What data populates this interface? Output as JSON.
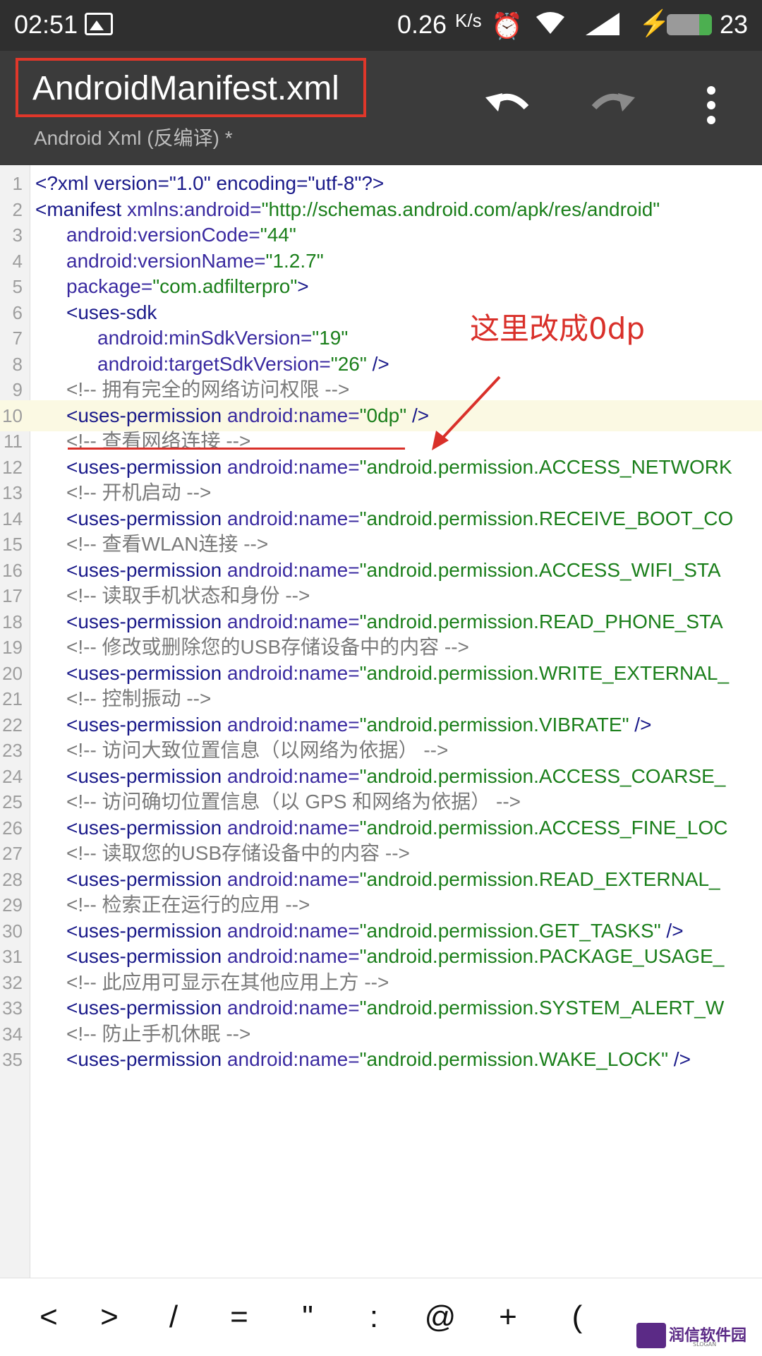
{
  "status_bar": {
    "time": "02:51",
    "net_speed": "0.26",
    "net_unit": "K/s",
    "battery": "23"
  },
  "toolbar": {
    "filename": "AndroidManifest.xml",
    "subtitle": "Android Xml (反编译) *",
    "icons": {
      "undo": "undo-icon",
      "redo": "redo-icon",
      "more": "more-vert-icon"
    }
  },
  "annotation": {
    "text": "这里改成0dp",
    "color": "#d9302a"
  },
  "colors": {
    "tag": "#1a1a8a",
    "value": "#1b7f1b",
    "comment": "#7a7a7a",
    "highlight": "#fbf9e3",
    "toolbar": "#3b3b3b"
  },
  "editor": {
    "lines": [
      {
        "num": "1",
        "parts": [
          {
            "t": "<?xml version=\"1.0\" encoding=\"utf-8\"?>",
            "c": "tag"
          }
        ]
      },
      {
        "num": "2",
        "parts": [
          {
            "t": "<manifest ",
            "c": "tag"
          },
          {
            "t": "xmlns:android=",
            "c": "attr"
          },
          {
            "t": "\"http://schemas.android.com/apk/res/android\"",
            "c": "val"
          }
        ]
      },
      {
        "num": "3",
        "parts": [
          {
            "t": "android:versionCode=",
            "c": "attr"
          },
          {
            "t": "\"44\"",
            "c": "val"
          }
        ]
      },
      {
        "num": "4",
        "parts": [
          {
            "t": "android:versionName=",
            "c": "attr"
          },
          {
            "t": "\"1.2.7\"",
            "c": "val"
          }
        ]
      },
      {
        "num": "5",
        "parts": [
          {
            "t": "package=",
            "c": "attr"
          },
          {
            "t": "\"com.adfilterpro\"",
            "c": "val"
          },
          {
            "t": ">",
            "c": "tag"
          }
        ]
      },
      {
        "num": "6",
        "parts": [
          {
            "t": "<uses-sdk",
            "c": "tag"
          }
        ]
      },
      {
        "num": "7",
        "parts": [
          {
            "t": "android:minSdkVersion=",
            "c": "attr"
          },
          {
            "t": "\"19\"",
            "c": "val"
          }
        ]
      },
      {
        "num": "8",
        "parts": [
          {
            "t": "android:targetSdkVersion=",
            "c": "attr"
          },
          {
            "t": "\"26\"",
            "c": "val"
          },
          {
            "t": " />",
            "c": "tag"
          }
        ]
      },
      {
        "num": "9",
        "parts": [
          {
            "t": "<!-- 拥有完全的网络访问权限 -->",
            "c": "comment"
          }
        ]
      },
      {
        "num": "10",
        "parts": [
          {
            "t": "<uses-permission ",
            "c": "tag"
          },
          {
            "t": "android:name=",
            "c": "attr"
          },
          {
            "t": "\"0dp\"",
            "c": "val"
          },
          {
            "t": " />",
            "c": "tag"
          }
        ]
      },
      {
        "num": "11",
        "parts": [
          {
            "t": "<!-- 查看网络连接 -->",
            "c": "comment"
          }
        ]
      },
      {
        "num": "12",
        "parts": [
          {
            "t": "<uses-permission ",
            "c": "tag"
          },
          {
            "t": "android:name=",
            "c": "attr"
          },
          {
            "t": "\"android.permission.ACCESS_NETWORK",
            "c": "val"
          }
        ]
      },
      {
        "num": "13",
        "parts": [
          {
            "t": "<!-- 开机启动 -->",
            "c": "comment"
          }
        ]
      },
      {
        "num": "14",
        "parts": [
          {
            "t": "<uses-permission ",
            "c": "tag"
          },
          {
            "t": "android:name=",
            "c": "attr"
          },
          {
            "t": "\"android.permission.RECEIVE_BOOT_CO",
            "c": "val"
          }
        ]
      },
      {
        "num": "15",
        "parts": [
          {
            "t": "<!-- 查看WLAN连接 -->",
            "c": "comment"
          }
        ]
      },
      {
        "num": "16",
        "parts": [
          {
            "t": "<uses-permission ",
            "c": "tag"
          },
          {
            "t": "android:name=",
            "c": "attr"
          },
          {
            "t": "\"android.permission.ACCESS_WIFI_STA",
            "c": "val"
          }
        ]
      },
      {
        "num": "17",
        "parts": [
          {
            "t": "<!-- 读取手机状态和身份 -->",
            "c": "comment"
          }
        ]
      },
      {
        "num": "18",
        "parts": [
          {
            "t": "<uses-permission ",
            "c": "tag"
          },
          {
            "t": "android:name=",
            "c": "attr"
          },
          {
            "t": "\"android.permission.READ_PHONE_STA",
            "c": "val"
          }
        ]
      },
      {
        "num": "19",
        "parts": [
          {
            "t": "<!-- 修改或删除您的USB存储设备中的内容 -->",
            "c": "comment"
          }
        ]
      },
      {
        "num": "20",
        "parts": [
          {
            "t": "<uses-permission ",
            "c": "tag"
          },
          {
            "t": "android:name=",
            "c": "attr"
          },
          {
            "t": "\"android.permission.WRITE_EXTERNAL_",
            "c": "val"
          }
        ]
      },
      {
        "num": "21",
        "parts": [
          {
            "t": "<!-- 控制振动 -->",
            "c": "comment"
          }
        ]
      },
      {
        "num": "22",
        "parts": [
          {
            "t": "<uses-permission ",
            "c": "tag"
          },
          {
            "t": "android:name=",
            "c": "attr"
          },
          {
            "t": "\"android.permission.VIBRATE\"",
            "c": "val"
          },
          {
            "t": " />",
            "c": "tag"
          }
        ]
      },
      {
        "num": "23",
        "parts": [
          {
            "t": "<!-- 访问大致位置信息（以网络为依据） -->",
            "c": "comment"
          }
        ]
      },
      {
        "num": "24",
        "parts": [
          {
            "t": "<uses-permission ",
            "c": "tag"
          },
          {
            "t": "android:name=",
            "c": "attr"
          },
          {
            "t": "\"android.permission.ACCESS_COARSE_",
            "c": "val"
          }
        ]
      },
      {
        "num": "25",
        "parts": [
          {
            "t": "<!-- 访问确切位置信息（以 GPS 和网络为依据） -->",
            "c": "comment"
          }
        ]
      },
      {
        "num": "26",
        "parts": [
          {
            "t": "<uses-permission ",
            "c": "tag"
          },
          {
            "t": "android:name=",
            "c": "attr"
          },
          {
            "t": "\"android.permission.ACCESS_FINE_LOC",
            "c": "val"
          }
        ]
      },
      {
        "num": "27",
        "parts": [
          {
            "t": "<!-- 读取您的USB存储设备中的内容 -->",
            "c": "comment"
          }
        ]
      },
      {
        "num": "28",
        "parts": [
          {
            "t": "<uses-permission ",
            "c": "tag"
          },
          {
            "t": "android:name=",
            "c": "attr"
          },
          {
            "t": "\"android.permission.READ_EXTERNAL_",
            "c": "val"
          }
        ]
      },
      {
        "num": "29",
        "parts": [
          {
            "t": "<!-- 检索正在运行的应用 -->",
            "c": "comment"
          }
        ]
      },
      {
        "num": "30",
        "parts": [
          {
            "t": "<uses-permission ",
            "c": "tag"
          },
          {
            "t": "android:name=",
            "c": "attr"
          },
          {
            "t": "\"android.permission.GET_TASKS\"",
            "c": "val"
          },
          {
            "t": " />",
            "c": "tag"
          }
        ]
      },
      {
        "num": "31",
        "parts": [
          {
            "t": "<uses-permission ",
            "c": "tag"
          },
          {
            "t": "android:name=",
            "c": "attr"
          },
          {
            "t": "\"android.permission.PACKAGE_USAGE_",
            "c": "val"
          }
        ]
      },
      {
        "num": "32",
        "parts": [
          {
            "t": "<!-- 此应用可显示在其他应用上方 -->",
            "c": "comment"
          }
        ]
      },
      {
        "num": "33",
        "parts": [
          {
            "t": "<uses-permission ",
            "c": "tag"
          },
          {
            "t": "android:name=",
            "c": "attr"
          },
          {
            "t": "\"android.permission.SYSTEM_ALERT_W",
            "c": "val"
          }
        ]
      },
      {
        "num": "34",
        "parts": [
          {
            "t": "<!-- 防止手机休眠 -->",
            "c": "comment"
          }
        ]
      },
      {
        "num": "35",
        "parts": [
          {
            "t": "<uses-permission ",
            "c": "tag"
          },
          {
            "t": "android:name=",
            "c": "attr"
          },
          {
            "t": "\"android.permission.WAKE_LOCK\"",
            "c": "val"
          },
          {
            "t": " />",
            "c": "tag"
          }
        ]
      }
    ],
    "highlighted_line": "10"
  },
  "symbol_bar": {
    "keys": [
      "<",
      ">",
      "/",
      "=",
      "\"",
      ":",
      "@",
      "+",
      "("
    ]
  },
  "watermark": {
    "text": "润信软件园",
    "sub": "SLOGAN"
  }
}
